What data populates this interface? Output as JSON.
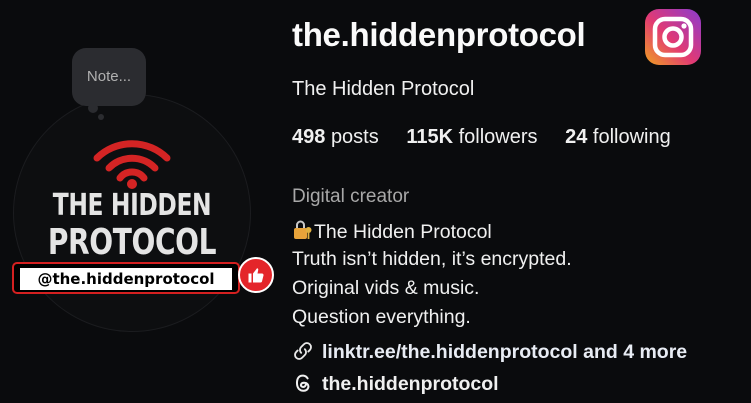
{
  "profile": {
    "username": "the.hiddenprotocol",
    "full_name": "The Hidden Protocol",
    "stats": {
      "posts_count": "498",
      "posts_label": "posts",
      "followers_count": "115K",
      "followers_label": "followers",
      "following_count": "24",
      "following_label": "following"
    },
    "category": "Digital creator",
    "bio": {
      "line1": "The Hidden Protocol",
      "line2": "Truth isn’t hidden, it’s encrypted.",
      "line3": "Original vids & music.",
      "line4": "Question everything."
    },
    "link": "linktr.ee/the.hiddenprotocol and 4 more",
    "threads_handle": "the.hiddenprotocol"
  },
  "avatar": {
    "note_placeholder": "Note...",
    "logo_line1": "THE HIDDEN",
    "logo_line2": "PROTOCOL",
    "handle_badge": "@the.hiddenprotocol"
  },
  "icons": {
    "brand": "instagram-icon",
    "bio_prefix": "locked-key-icon",
    "link": "link-icon",
    "threads": "threads-icon",
    "like": "thumbs-up-icon",
    "signal": "wifi-signal-icon"
  },
  "colors": {
    "background": "#0a0b0d",
    "accent_red": "#d52020",
    "secondary_text": "#a8a8a8"
  }
}
